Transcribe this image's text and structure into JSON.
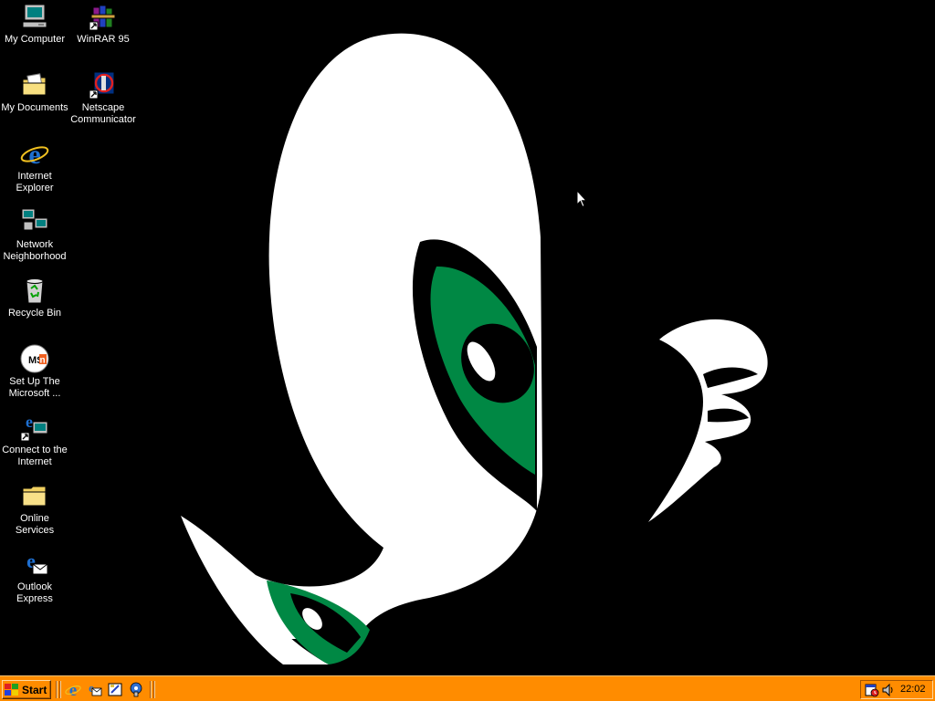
{
  "desktop": {
    "icons": [
      {
        "label": "My Computer",
        "icon": "computer-icon"
      },
      {
        "label": "WinRAR 95",
        "icon": "winrar-icon"
      },
      {
        "label": "My Documents",
        "icon": "folder-documents-icon"
      },
      {
        "label": "Netscape\nCommunicator",
        "icon": "netscape-icon"
      },
      {
        "label": "Internet\nExplorer",
        "icon": "internet-explorer-icon"
      },
      {
        "label": "Network\nNeighborhood",
        "icon": "network-icon"
      },
      {
        "label": "Recycle Bin",
        "icon": "recycle-bin-icon"
      },
      {
        "label": "Set Up The\nMicrosoft ...",
        "icon": "msn-icon"
      },
      {
        "label": "Connect to the\nInternet",
        "icon": "connect-internet-icon"
      },
      {
        "label": "Online\nServices",
        "icon": "folder-icon"
      },
      {
        "label": "Outlook\nExpress",
        "icon": "outlook-express-icon"
      }
    ],
    "wallpaper_colors": {
      "background": "#000000",
      "white": "#ffffff",
      "green": "#008844"
    }
  },
  "taskbar": {
    "color": "#ff8c00",
    "start_label": "Start",
    "quick_launch": [
      "internet-explorer-icon",
      "outlook-express-icon",
      "show-desktop-icon",
      "channels-icon"
    ],
    "tray": {
      "icons": [
        "task-scheduler-icon",
        "volume-icon"
      ],
      "clock": "22:02"
    }
  }
}
